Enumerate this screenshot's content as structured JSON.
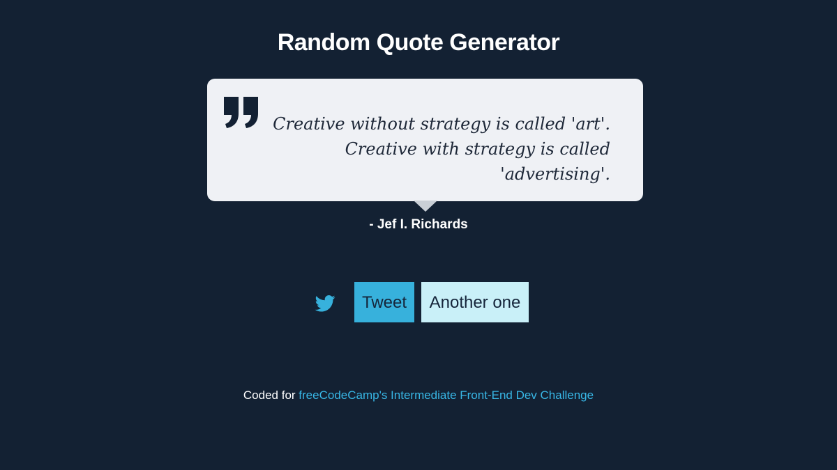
{
  "header": {
    "title": "Random Quote Generator"
  },
  "quote": {
    "icon": "quote-mark-icon",
    "lines": [
      "Creative without strategy is called 'art'.",
      "Creative with strategy is called 'advertising'."
    ],
    "author": "- Jef I. Richards"
  },
  "actions": {
    "twitter_icon": "twitter-icon",
    "tweet_label": "Tweet",
    "another_label": "Another one"
  },
  "footer": {
    "prefix": "Coded for ",
    "link_text": "freeCodeCamp's Intermediate Front-End Dev Challenge"
  },
  "colors": {
    "background": "#132133",
    "card": "#eff1f5",
    "tweet": "#37b1dc",
    "another": "#c9f0f8",
    "link": "#38b7e6",
    "text_dark": "#15253a"
  }
}
